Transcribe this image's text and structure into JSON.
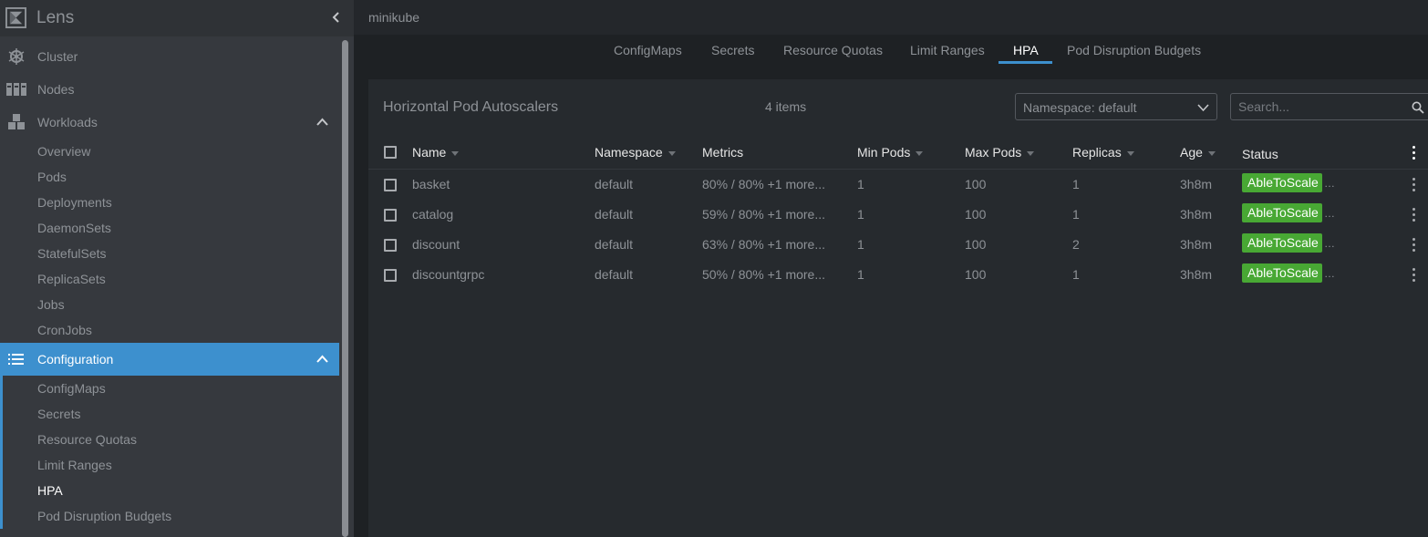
{
  "app": {
    "title": "Lens"
  },
  "sidebar": {
    "items": [
      {
        "label": "Cluster",
        "icon": "helm-wheel-icon"
      },
      {
        "label": "Nodes",
        "icon": "server-rack-icon"
      },
      {
        "label": "Workloads",
        "icon": "cubes-icon"
      },
      {
        "label": "Configuration",
        "icon": "list-icon"
      }
    ],
    "workloads_sub": [
      "Overview",
      "Pods",
      "Deployments",
      "DaemonSets",
      "StatefulSets",
      "ReplicaSets",
      "Jobs",
      "CronJobs"
    ],
    "configuration_sub": [
      "ConfigMaps",
      "Secrets",
      "Resource Quotas",
      "Limit Ranges",
      "HPA",
      "Pod Disruption Budgets"
    ],
    "current_sub": "HPA",
    "accent_color": "#3d90ce"
  },
  "topbar": {
    "cluster": "minikube"
  },
  "tabs": [
    "ConfigMaps",
    "Secrets",
    "Resource Quotas",
    "Limit Ranges",
    "HPA",
    "Pod Disruption Budgets"
  ],
  "active_tab": "HPA",
  "panel": {
    "title": "Horizontal Pod Autoscalers",
    "count": "4 items",
    "namespace_select": "Namespace: default",
    "search_placeholder": "Search..."
  },
  "table": {
    "columns": [
      "Name",
      "Namespace",
      "Metrics",
      "Min Pods",
      "Max Pods",
      "Replicas",
      "Age",
      "Status"
    ],
    "rows": [
      {
        "name": "basket",
        "namespace": "default",
        "metrics": "80% / 80% +1 more...",
        "min": "1",
        "max": "100",
        "replicas": "1",
        "age": "3h8m",
        "status": "AbleToScale"
      },
      {
        "name": "catalog",
        "namespace": "default",
        "metrics": "59% / 80% +1 more...",
        "min": "1",
        "max": "100",
        "replicas": "1",
        "age": "3h8m",
        "status": "AbleToScale"
      },
      {
        "name": "discount",
        "namespace": "default",
        "metrics": "63% / 80% +1 more...",
        "min": "1",
        "max": "100",
        "replicas": "2",
        "age": "3h8m",
        "status": "AbleToScale"
      },
      {
        "name": "discountgrpc",
        "namespace": "default",
        "metrics": "50% / 80% +1 more...",
        "min": "1",
        "max": "100",
        "replicas": "1",
        "age": "3h8m",
        "status": "AbleToScale"
      }
    ],
    "status_color": "#48a834"
  }
}
